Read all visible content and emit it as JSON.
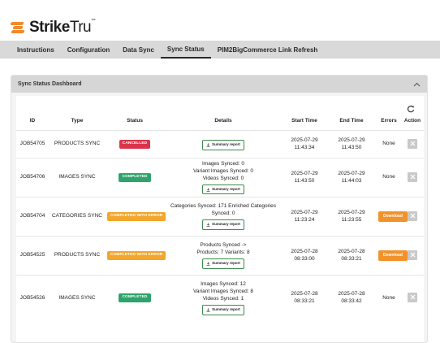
{
  "brand": {
    "name_bold": "Strike",
    "name_thin": "Tru",
    "tm": "™",
    "accent": "#f2892b"
  },
  "tabs": [
    {
      "label": "Instructions"
    },
    {
      "label": "Configuration"
    },
    {
      "label": "Data Sync"
    },
    {
      "label": "Sync Status",
      "active": true
    },
    {
      "label": "PIM2BigCommerce Link Refresh"
    }
  ],
  "panel": {
    "title": "Sync Status Dashboard"
  },
  "table": {
    "headers": [
      "ID",
      "Type",
      "Status",
      "Details",
      "Start Time",
      "End Time",
      "Errors",
      "Action"
    ],
    "summary_label": "Summary report",
    "download_label": "Download",
    "rows": [
      {
        "id": "JOB54705",
        "type": "PRODUCTS SYNC",
        "status": "CANCELLED",
        "status_color": "#d9354a",
        "details": [],
        "start": [
          "2025-07-29",
          "11:43:34"
        ],
        "end": [
          "2025-07-29",
          "11:43:50"
        ],
        "errors": "None"
      },
      {
        "id": "JOB54706",
        "type": "IMAGES SYNC",
        "status": "COMPLETED",
        "status_color": "#2ea36b",
        "details": [
          "Images Synced: 0",
          "Variant Images Synced: 0",
          "Videos Synced: 0"
        ],
        "start": [
          "2025-07-29",
          "11:43:50"
        ],
        "end": [
          "2025-07-29",
          "11:44:03"
        ],
        "errors": "None"
      },
      {
        "id": "JOB54704",
        "type": "CATEGORIES SYNC",
        "status": "COMPLETED WITH ERROR",
        "status_color": "#f2a62b",
        "details": [
          "Categories Synced: 171 Enriched Categories",
          "Synced: 0"
        ],
        "start": [
          "2025-07-29",
          "11:23:24"
        ],
        "end": [
          "2025-07-29",
          "11:23:55"
        ],
        "errors": "Download"
      },
      {
        "id": "JOB54525",
        "type": "PRODUCTS SYNC",
        "status": "COMPLETED WITH ERROR",
        "status_color": "#f2a62b",
        "details": [
          "Products Synced ->",
          "Products: 7 Variants: 8"
        ],
        "start": [
          "2025-07-28",
          "08:33:00"
        ],
        "end": [
          "2025-07-28",
          "08:33:21"
        ],
        "errors": "Download"
      },
      {
        "id": "JOB54526",
        "type": "IMAGES SYNC",
        "status": "COMPLETED",
        "status_color": "#2ea36b",
        "details": [
          "Images Synced: 12",
          "Variant Images Synced: 8",
          "Videos Synced: 1"
        ],
        "start": [
          "2025-07-28",
          "08:33:21"
        ],
        "end": [
          "2025-07-28",
          "08:33:42"
        ],
        "errors": "None"
      }
    ]
  },
  "icons": {
    "collapse": "chevron-up-icon",
    "refresh": "refresh-icon",
    "summary": "download-icon",
    "action": "close-icon"
  }
}
